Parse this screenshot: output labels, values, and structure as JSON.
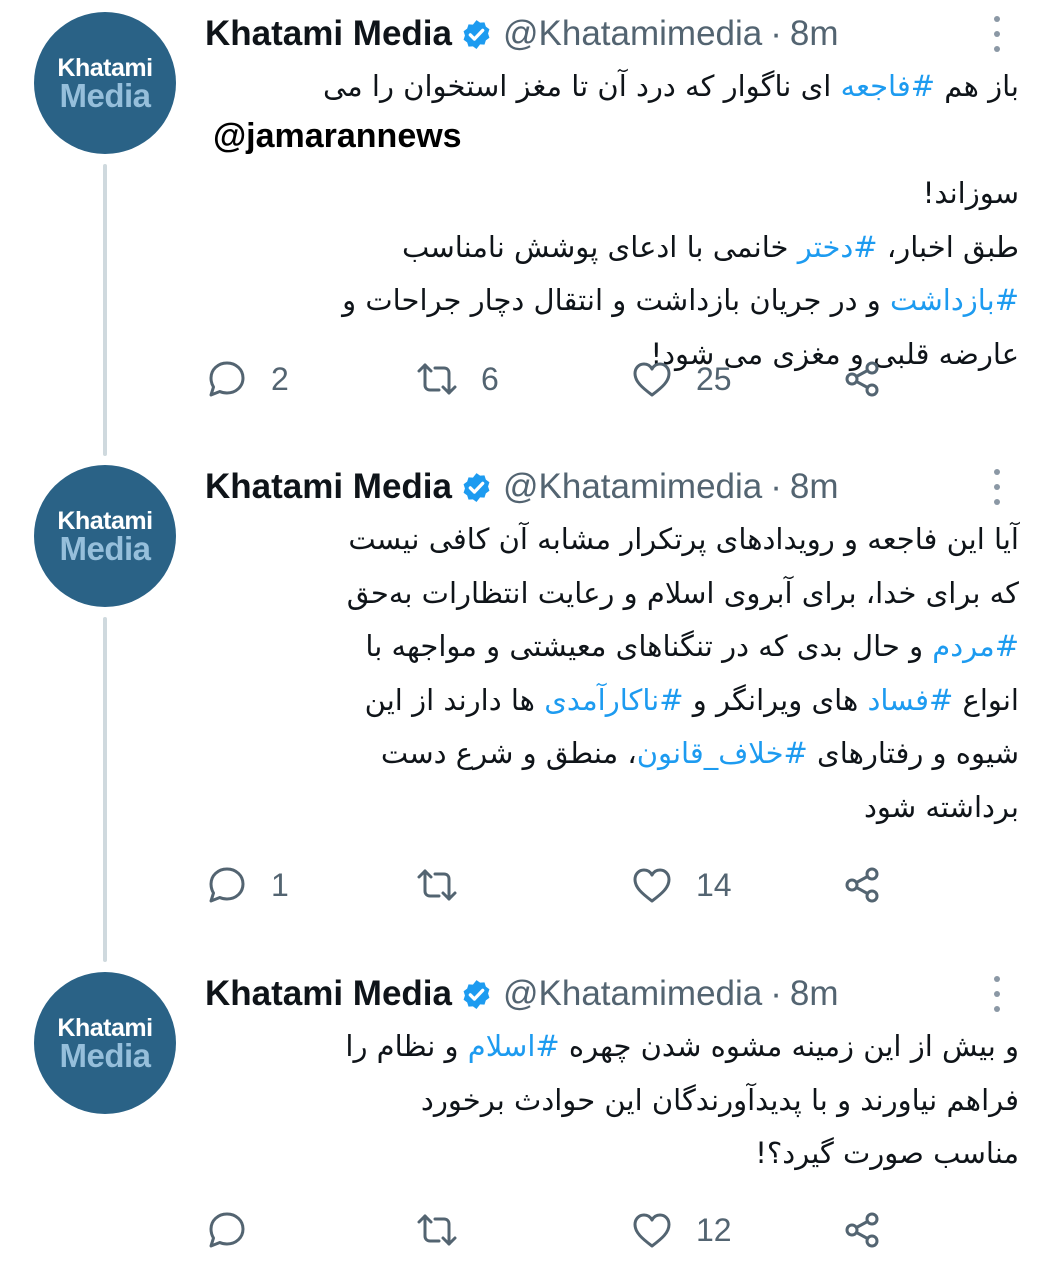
{
  "account": {
    "display_name": "Khatami Media",
    "handle": "@Khatamimedia",
    "separator": "·",
    "avatar_line1": "Khatami",
    "avatar_line2": "Media",
    "accent_color": "#1d9bf0",
    "avatar_color": "#2a6286"
  },
  "icons": {
    "reply": "reply-icon",
    "retweet": "retweet-icon",
    "like": "heart-icon",
    "share": "share-icon",
    "more": "more-icon",
    "verified": "verified-badge-icon"
  },
  "tweets": [
    {
      "time": "8m",
      "line1": {
        "a": "باز هم ",
        "h": "#فاجعه",
        "b": " ای ناگوار که درد آن تا مغز استخوان را می"
      },
      "mention": "@jamarannews",
      "line2": "سوزاند!",
      "line3": {
        "a": "طبق اخبار، ",
        "h": "#دختر",
        "b": " خانمی با ادعای پوشش نامناسب"
      },
      "line4": {
        "h": "#بازداشت",
        "b": " و در جریان بازداشت و انتقال دچار جراحات و"
      },
      "line5": "عارضه قلبی و مغزی می شود!",
      "replies": "2",
      "retweets": "6",
      "likes": "25"
    },
    {
      "time": "8m",
      "line1": "آیا این فاجعه و رویدادهای پرتکرار مشابه آن کافی نیست",
      "line2": "که برای خدا، برای آبروی اسلام و رعایت انتظارات به‌حق",
      "line3": {
        "h": "#مردم",
        "b": " و حال بدی که در تنگناهای معیشتی و مواجهه با"
      },
      "line4": {
        "a": "انواع ",
        "h1": "#فساد",
        "b": " های ویرانگر و ",
        "h2": "#ناکارآمدی",
        "c": " ها دارند از این"
      },
      "line5": {
        "a": "شیوه و رفتارهای ",
        "h": "#خلاف_قانون",
        "b": "، منطق و شرع دست"
      },
      "line6": "برداشته شود",
      "replies": "1",
      "retweets": "",
      "likes": "14"
    },
    {
      "time": "8m",
      "line1": {
        "a": "و بیش از این زمینه مشوه شدن چهره ",
        "h": "#اسلام",
        "b": " و نظام را"
      },
      "line2": "فراهم نیاورند و با پدیدآورندگان این حوادث برخورد",
      "line3": "مناسب صورت گیرد؟!",
      "replies": "",
      "retweets": "",
      "likes": "12"
    }
  ]
}
